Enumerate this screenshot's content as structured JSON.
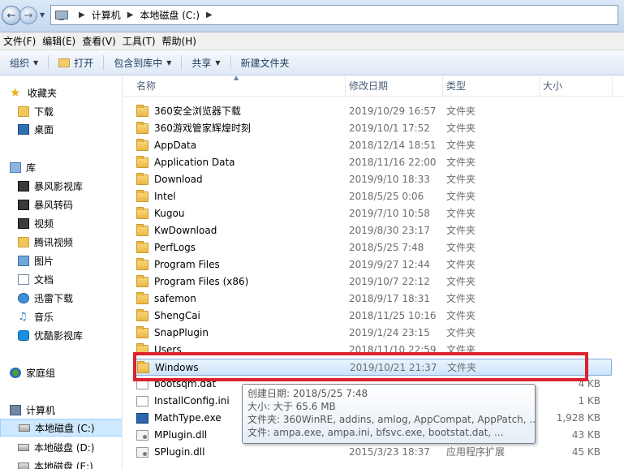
{
  "address_bar": {
    "crumbs": [
      "计算机",
      "本地磁盘 (C:)"
    ]
  },
  "menu": [
    "文件(F)",
    "编辑(E)",
    "查看(V)",
    "工具(T)",
    "帮助(H)"
  ],
  "toolbar": {
    "organize": "组织",
    "open": "打开",
    "include_library": "包含到库中",
    "share": "共享",
    "new_folder": "新建文件夹"
  },
  "nav": {
    "favorites": "收藏夹",
    "downloads": "下载",
    "desktop": "桌面",
    "libraries": "库",
    "baofeng_video_lib": "暴风影视库",
    "baofeng_transcode": "暴风转码",
    "videos": "视频",
    "tencent_video": "腾讯视频",
    "pictures": "图片",
    "documents": "文档",
    "xunlei_download": "迅雷下载",
    "music": "音乐",
    "youku_video_lib": "优酷影视库",
    "homegroup": "家庭组",
    "computer": "计算机",
    "drive_c": "本地磁盘 (C:)",
    "drive_d": "本地磁盘 (D:)",
    "drive_e": "本地磁盘 (E:)"
  },
  "columns": {
    "name": "名称",
    "modified": "修改日期",
    "type": "类型",
    "size": "大小"
  },
  "files": [
    {
      "name": "360安全浏览器下载",
      "date": "2019/10/29 16:57",
      "type": "文件夹",
      "size": "",
      "icon": "folder"
    },
    {
      "name": "360游戏管家辉煌时刻",
      "date": "2019/10/1 17:52",
      "type": "文件夹",
      "size": "",
      "icon": "folder"
    },
    {
      "name": "AppData",
      "date": "2018/12/14 18:51",
      "type": "文件夹",
      "size": "",
      "icon": "folder"
    },
    {
      "name": "Application Data",
      "date": "2018/11/16 22:00",
      "type": "文件夹",
      "size": "",
      "icon": "folder"
    },
    {
      "name": "Download",
      "date": "2019/9/10 18:33",
      "type": "文件夹",
      "size": "",
      "icon": "folder"
    },
    {
      "name": "Intel",
      "date": "2018/5/25 0:06",
      "type": "文件夹",
      "size": "",
      "icon": "folder"
    },
    {
      "name": "Kugou",
      "date": "2019/7/10 10:58",
      "type": "文件夹",
      "size": "",
      "icon": "folder"
    },
    {
      "name": "KwDownload",
      "date": "2019/8/30 23:17",
      "type": "文件夹",
      "size": "",
      "icon": "folder"
    },
    {
      "name": "PerfLogs",
      "date": "2018/5/25 7:48",
      "type": "文件夹",
      "size": "",
      "icon": "folder"
    },
    {
      "name": "Program Files",
      "date": "2019/9/27 12:44",
      "type": "文件夹",
      "size": "",
      "icon": "folder"
    },
    {
      "name": "Program Files (x86)",
      "date": "2019/10/7 22:12",
      "type": "文件夹",
      "size": "",
      "icon": "folder"
    },
    {
      "name": "safemon",
      "date": "2018/9/17 18:31",
      "type": "文件夹",
      "size": "",
      "icon": "folder"
    },
    {
      "name": "ShengCai",
      "date": "2018/11/25 10:16",
      "type": "文件夹",
      "size": "",
      "icon": "folder"
    },
    {
      "name": "SnapPlugin",
      "date": "2019/1/24 23:15",
      "type": "文件夹",
      "size": "",
      "icon": "folder"
    },
    {
      "name": "Users",
      "date": "2018/11/10 22:59",
      "type": "文件夹",
      "size": "",
      "icon": "folder"
    },
    {
      "name": "Windows",
      "date": "2019/10/21 21:37",
      "type": "文件夹",
      "size": "",
      "icon": "folder",
      "selected": true
    },
    {
      "name": "bootsqm.dat",
      "date": "",
      "type": "",
      "size": "4 KB",
      "icon": "file"
    },
    {
      "name": "InstallConfig.ini",
      "date": "",
      "type": "",
      "size": "1 KB",
      "icon": "file"
    },
    {
      "name": "MathType.exe",
      "date": "",
      "type": "",
      "size": "1,928 KB",
      "icon": "exe"
    },
    {
      "name": "MPlugin.dll",
      "date": "",
      "type": "",
      "size": "43 KB",
      "icon": "dll"
    },
    {
      "name": "SPlugin.dll",
      "date": "2015/3/23 18:37",
      "type": "应用程序扩展",
      "size": "45 KB",
      "icon": "dll"
    }
  ],
  "tooltip": {
    "created": "创建日期: 2018/5/25 7:48",
    "size": "大小: 大于 65.6 MB",
    "folders": "文件夹: 360WinRE, addins, amlog, AppCompat, AppPatch, ...",
    "files": "文件: ampa.exe, ampa.ini, bfsvc.exe, bootstat.dat, ..."
  },
  "colors": {
    "highlight": "#d9232e",
    "selection": "#cde4fb"
  }
}
